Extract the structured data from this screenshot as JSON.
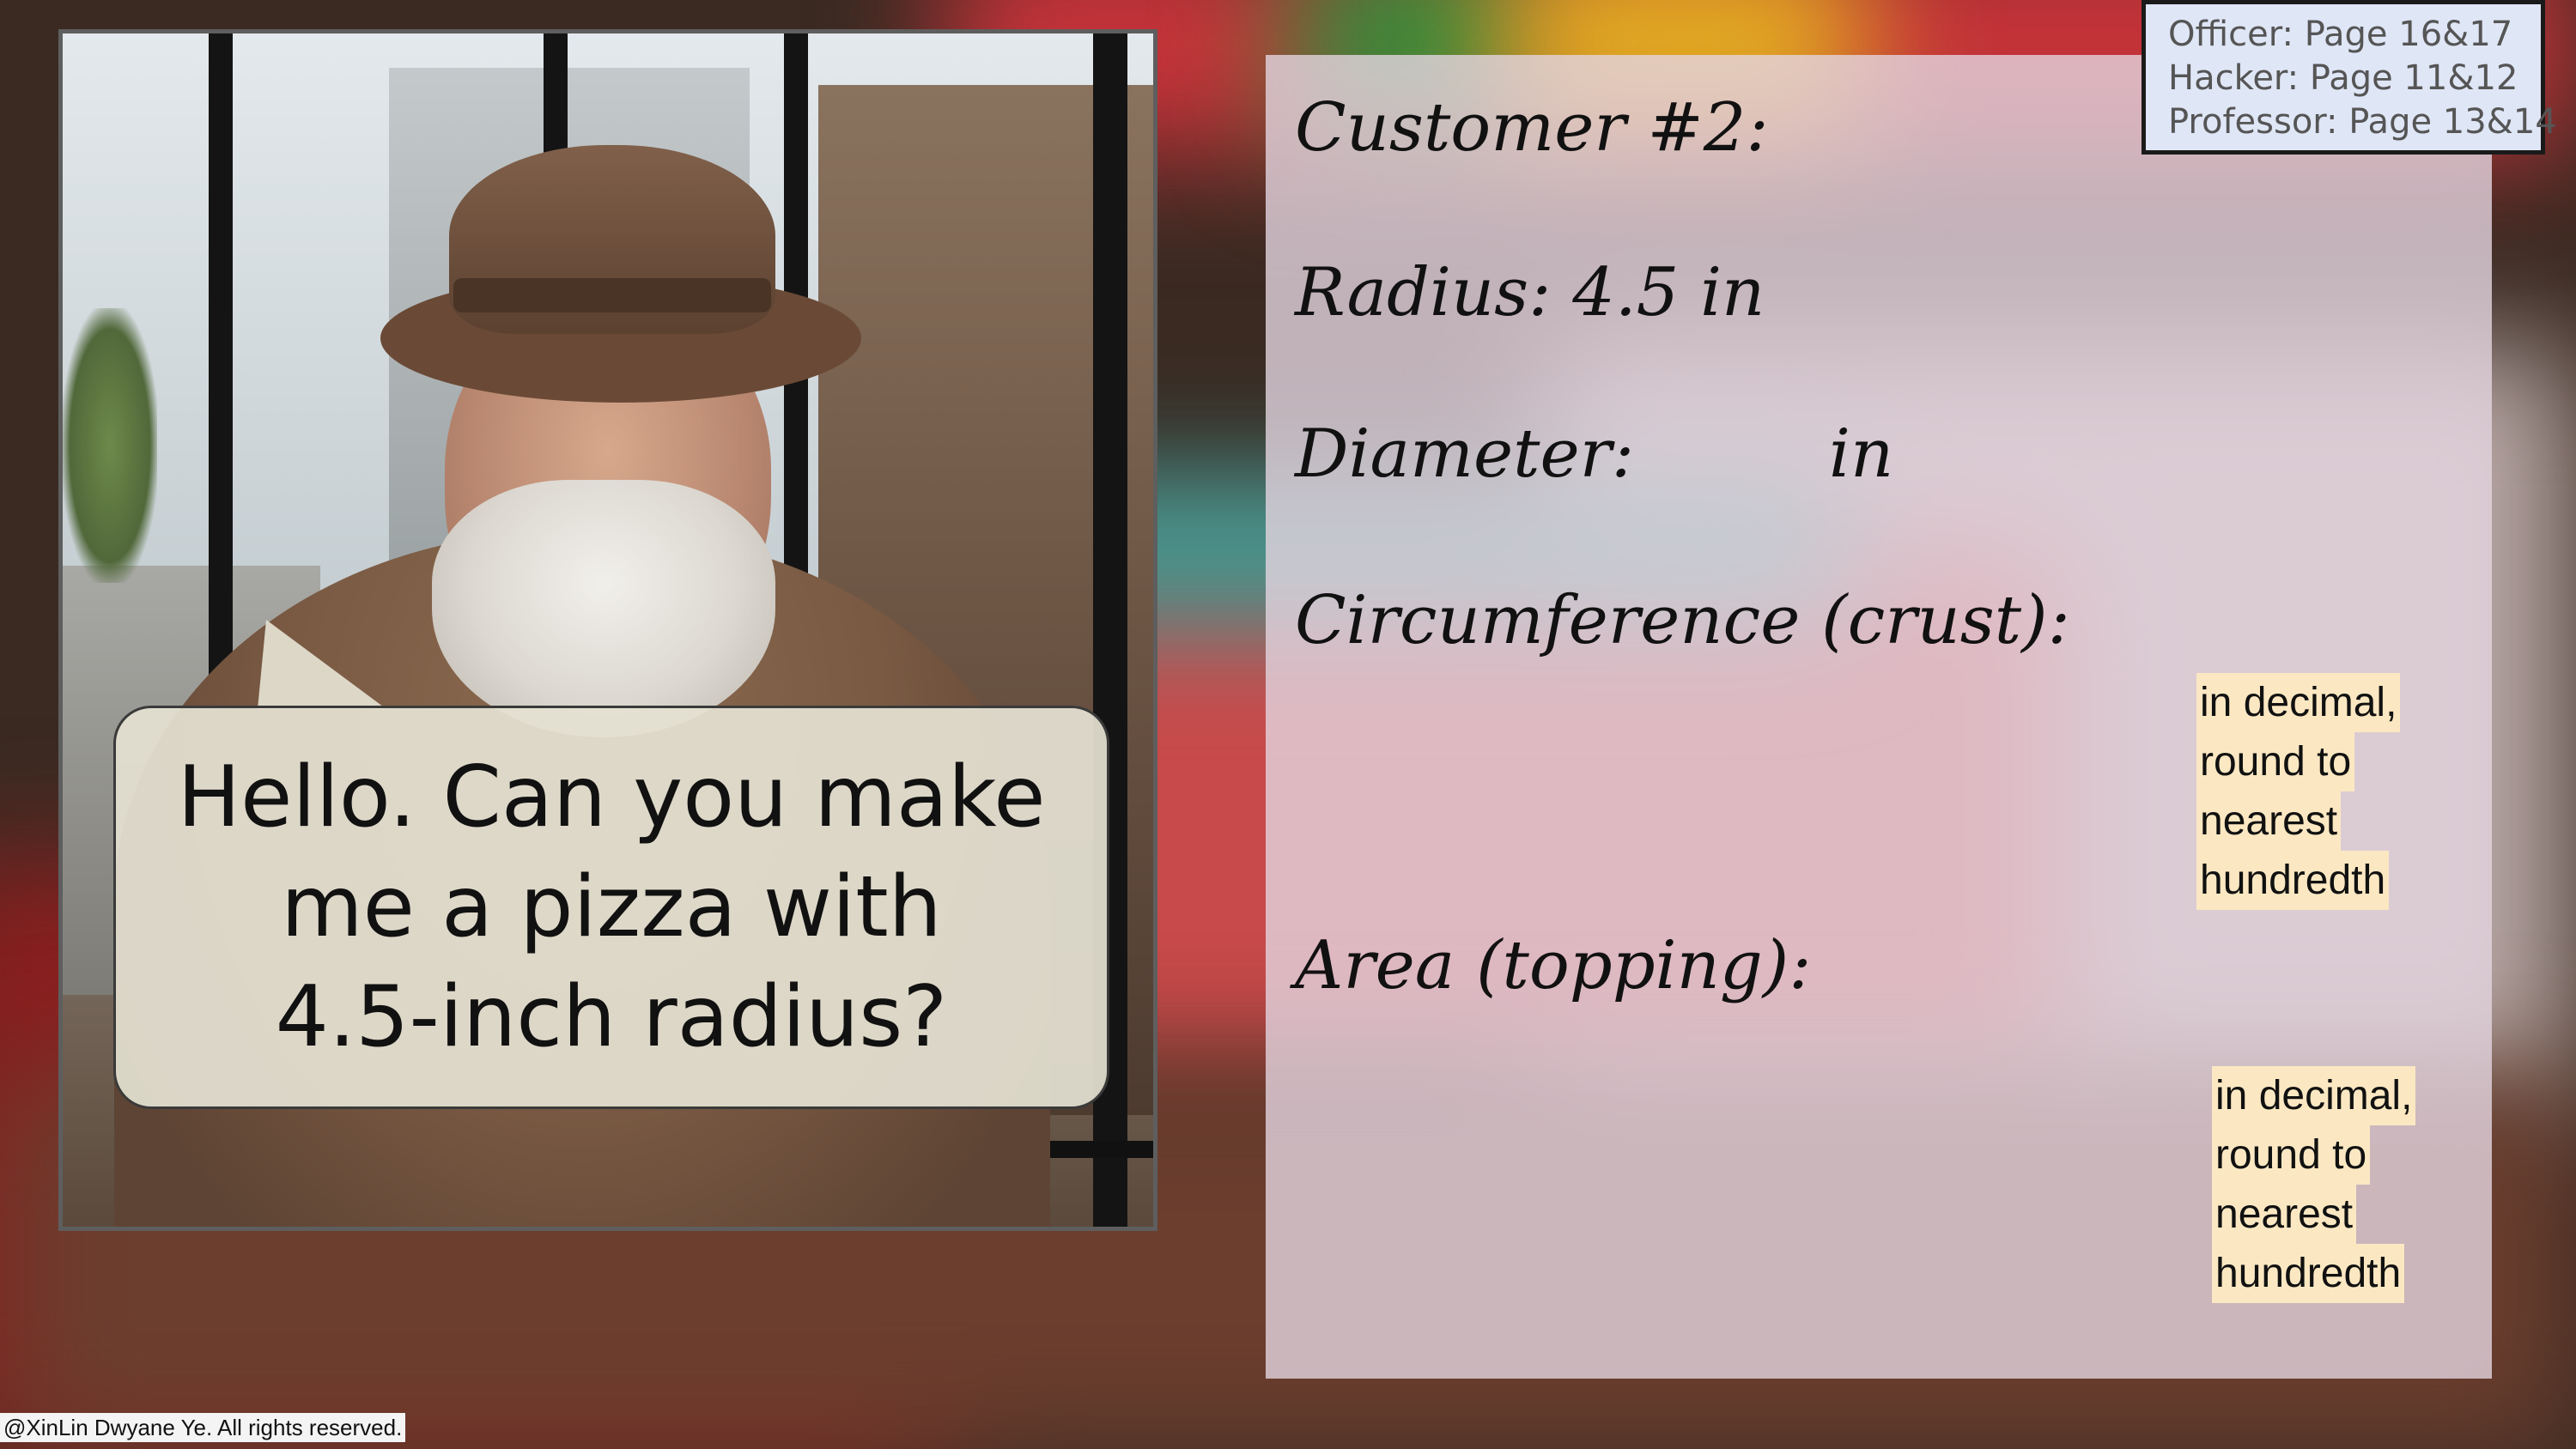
{
  "speech_bubble": {
    "line1": "Hello. Can you make",
    "line2": "me a pizza with",
    "line3": "4.5-inch radius?"
  },
  "worksheet": {
    "customer_label": "Customer #2:",
    "radius_label": "Radius: 4.5 in",
    "diameter_label": "Diameter:",
    "diameter_unit": "in",
    "circumference_label": "Circumference (crust):",
    "area_label": "Area (topping):",
    "circumference_note": [
      "in decimal,",
      "round to",
      "nearest",
      "hundredth"
    ],
    "area_note": [
      "in decimal,",
      "round to",
      "nearest",
      "hundredth"
    ]
  },
  "page_refs": [
    "Officer: Page 16&17",
    "Hacker: Page 11&12",
    "Professor: Page 13&14"
  ],
  "copyright": "@XinLin Dwyane Ye. All rights reserved.",
  "colors": {
    "panel": "#e4d4e0",
    "note_highlight": "#fbe8c2",
    "refs_box": "#dfe6f6"
  }
}
